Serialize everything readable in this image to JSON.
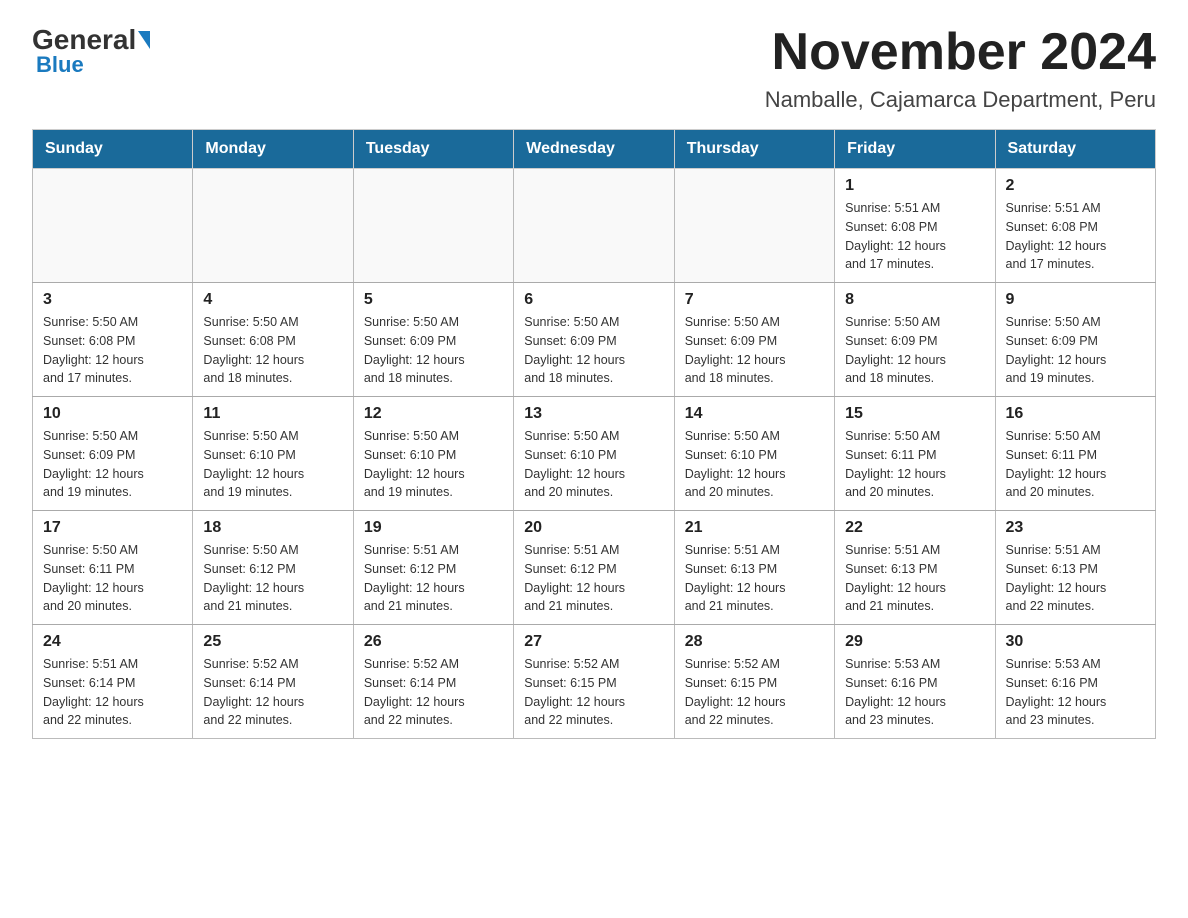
{
  "logo": {
    "text_general": "General",
    "text_blue": "Blue"
  },
  "header": {
    "title": "November 2024",
    "subtitle": "Namballe, Cajamarca Department, Peru"
  },
  "weekdays": [
    "Sunday",
    "Monday",
    "Tuesday",
    "Wednesday",
    "Thursday",
    "Friday",
    "Saturday"
  ],
  "weeks": [
    [
      {
        "day": "",
        "info": ""
      },
      {
        "day": "",
        "info": ""
      },
      {
        "day": "",
        "info": ""
      },
      {
        "day": "",
        "info": ""
      },
      {
        "day": "",
        "info": ""
      },
      {
        "day": "1",
        "info": "Sunrise: 5:51 AM\nSunset: 6:08 PM\nDaylight: 12 hours\nand 17 minutes."
      },
      {
        "day": "2",
        "info": "Sunrise: 5:51 AM\nSunset: 6:08 PM\nDaylight: 12 hours\nand 17 minutes."
      }
    ],
    [
      {
        "day": "3",
        "info": "Sunrise: 5:50 AM\nSunset: 6:08 PM\nDaylight: 12 hours\nand 17 minutes."
      },
      {
        "day": "4",
        "info": "Sunrise: 5:50 AM\nSunset: 6:08 PM\nDaylight: 12 hours\nand 18 minutes."
      },
      {
        "day": "5",
        "info": "Sunrise: 5:50 AM\nSunset: 6:09 PM\nDaylight: 12 hours\nand 18 minutes."
      },
      {
        "day": "6",
        "info": "Sunrise: 5:50 AM\nSunset: 6:09 PM\nDaylight: 12 hours\nand 18 minutes."
      },
      {
        "day": "7",
        "info": "Sunrise: 5:50 AM\nSunset: 6:09 PM\nDaylight: 12 hours\nand 18 minutes."
      },
      {
        "day": "8",
        "info": "Sunrise: 5:50 AM\nSunset: 6:09 PM\nDaylight: 12 hours\nand 18 minutes."
      },
      {
        "day": "9",
        "info": "Sunrise: 5:50 AM\nSunset: 6:09 PM\nDaylight: 12 hours\nand 19 minutes."
      }
    ],
    [
      {
        "day": "10",
        "info": "Sunrise: 5:50 AM\nSunset: 6:09 PM\nDaylight: 12 hours\nand 19 minutes."
      },
      {
        "day": "11",
        "info": "Sunrise: 5:50 AM\nSunset: 6:10 PM\nDaylight: 12 hours\nand 19 minutes."
      },
      {
        "day": "12",
        "info": "Sunrise: 5:50 AM\nSunset: 6:10 PM\nDaylight: 12 hours\nand 19 minutes."
      },
      {
        "day": "13",
        "info": "Sunrise: 5:50 AM\nSunset: 6:10 PM\nDaylight: 12 hours\nand 20 minutes."
      },
      {
        "day": "14",
        "info": "Sunrise: 5:50 AM\nSunset: 6:10 PM\nDaylight: 12 hours\nand 20 minutes."
      },
      {
        "day": "15",
        "info": "Sunrise: 5:50 AM\nSunset: 6:11 PM\nDaylight: 12 hours\nand 20 minutes."
      },
      {
        "day": "16",
        "info": "Sunrise: 5:50 AM\nSunset: 6:11 PM\nDaylight: 12 hours\nand 20 minutes."
      }
    ],
    [
      {
        "day": "17",
        "info": "Sunrise: 5:50 AM\nSunset: 6:11 PM\nDaylight: 12 hours\nand 20 minutes."
      },
      {
        "day": "18",
        "info": "Sunrise: 5:50 AM\nSunset: 6:12 PM\nDaylight: 12 hours\nand 21 minutes."
      },
      {
        "day": "19",
        "info": "Sunrise: 5:51 AM\nSunset: 6:12 PM\nDaylight: 12 hours\nand 21 minutes."
      },
      {
        "day": "20",
        "info": "Sunrise: 5:51 AM\nSunset: 6:12 PM\nDaylight: 12 hours\nand 21 minutes."
      },
      {
        "day": "21",
        "info": "Sunrise: 5:51 AM\nSunset: 6:13 PM\nDaylight: 12 hours\nand 21 minutes."
      },
      {
        "day": "22",
        "info": "Sunrise: 5:51 AM\nSunset: 6:13 PM\nDaylight: 12 hours\nand 21 minutes."
      },
      {
        "day": "23",
        "info": "Sunrise: 5:51 AM\nSunset: 6:13 PM\nDaylight: 12 hours\nand 22 minutes."
      }
    ],
    [
      {
        "day": "24",
        "info": "Sunrise: 5:51 AM\nSunset: 6:14 PM\nDaylight: 12 hours\nand 22 minutes."
      },
      {
        "day": "25",
        "info": "Sunrise: 5:52 AM\nSunset: 6:14 PM\nDaylight: 12 hours\nand 22 minutes."
      },
      {
        "day": "26",
        "info": "Sunrise: 5:52 AM\nSunset: 6:14 PM\nDaylight: 12 hours\nand 22 minutes."
      },
      {
        "day": "27",
        "info": "Sunrise: 5:52 AM\nSunset: 6:15 PM\nDaylight: 12 hours\nand 22 minutes."
      },
      {
        "day": "28",
        "info": "Sunrise: 5:52 AM\nSunset: 6:15 PM\nDaylight: 12 hours\nand 22 minutes."
      },
      {
        "day": "29",
        "info": "Sunrise: 5:53 AM\nSunset: 6:16 PM\nDaylight: 12 hours\nand 23 minutes."
      },
      {
        "day": "30",
        "info": "Sunrise: 5:53 AM\nSunset: 6:16 PM\nDaylight: 12 hours\nand 23 minutes."
      }
    ]
  ]
}
